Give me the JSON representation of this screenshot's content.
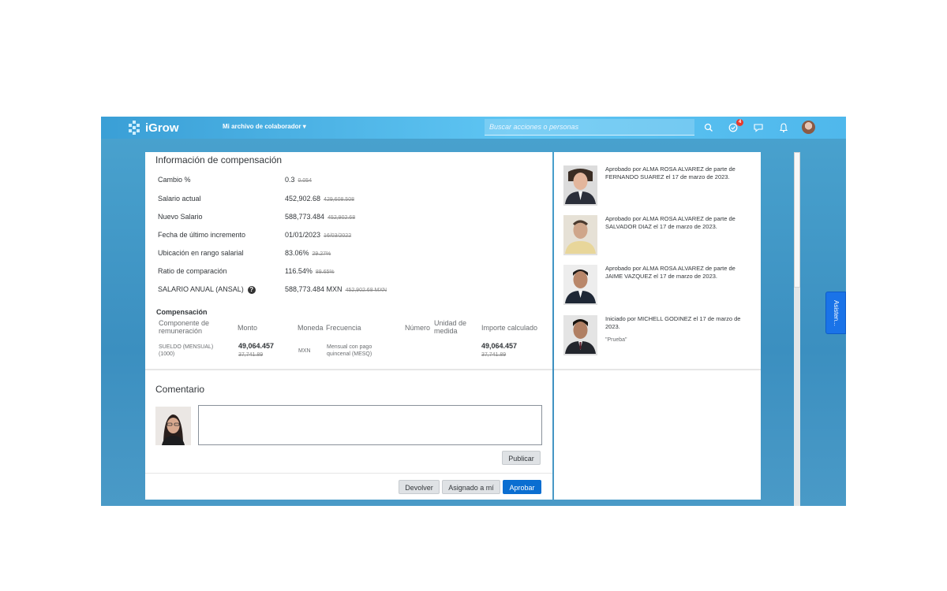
{
  "shell": {
    "app_name": "iGrow",
    "nav_menu": "Mi archivo de colaborador ▾",
    "search_placeholder": "Buscar acciones o personas",
    "notification_count": "4",
    "assistant": "Asisten..."
  },
  "compensation_info": {
    "title": "Información de compensación",
    "rows": [
      {
        "label": "Cambio %",
        "value": "0.3",
        "old": "0.054"
      },
      {
        "label": "Salario actual",
        "value": "452,902.68",
        "old": "429,608.508"
      },
      {
        "label": "Nuevo Salario",
        "value": "588,773.484",
        "old": "452,902.68"
      },
      {
        "label": "Fecha de último incremento",
        "value": "01/01/2023",
        "old": "16/03/2022"
      },
      {
        "label": "Ubicación en rango salarial",
        "value": "83.06%",
        "old": "29.27%"
      },
      {
        "label": "Ratio de comparación",
        "value": "116.54%",
        "old": "89.65%"
      },
      {
        "label": "SALARIO ANUAL (ANSAL)",
        "value": "588,773.484 MXN",
        "old": "452,902.68 MXN"
      }
    ]
  },
  "compensation_table": {
    "title": "Compensación",
    "headers": {
      "component": "Componente de remuneración",
      "amount": "Monto",
      "currency": "Moneda",
      "frequency": "Frecuencia",
      "number": "Número",
      "unit": "Unidad de medida",
      "calculated": "Importe calculado"
    },
    "row": {
      "component": "SUELDO (MENSUAL) (1000)",
      "amount": "49,064.457",
      "amount_old": "37,741.89",
      "currency": "MXN",
      "frequency": "Mensual con pago quincenal (MESQ)",
      "calculated": "49,064.457",
      "calculated_old": "37,741.89"
    }
  },
  "comment": {
    "title": "Comentario",
    "value": "",
    "publish": "Publicar"
  },
  "footer_actions": {
    "return": "Devolver",
    "assign_me": "Asignado a mí",
    "approve": "Aprobar"
  },
  "timeline": [
    {
      "text": "Aprobado por ALMA ROSA ALVAREZ de parte de FERNANDO SUAREZ el 17 de marzo de 2023.",
      "quote": ""
    },
    {
      "text": "Aprobado por ALMA ROSA ALVAREZ de parte de SALVADOR DIAZ el 17 de marzo de 2023.",
      "quote": ""
    },
    {
      "text": "Aprobado por ALMA ROSA ALVAREZ de parte de JAIME VAZQUEZ el 17 de marzo de 2023.",
      "quote": ""
    },
    {
      "text": "Iniciado por MICHELL GODINEZ el 17 de marzo de 2023.",
      "quote": "\"Prueba\""
    }
  ],
  "colors": {
    "shell_gradient_start": "#3a9fd6",
    "shell_gradient_end": "#5ec5f3",
    "primary_button": "#0a6ed1",
    "assistant_tab": "#1a73e8",
    "badge": "#e8392c"
  }
}
